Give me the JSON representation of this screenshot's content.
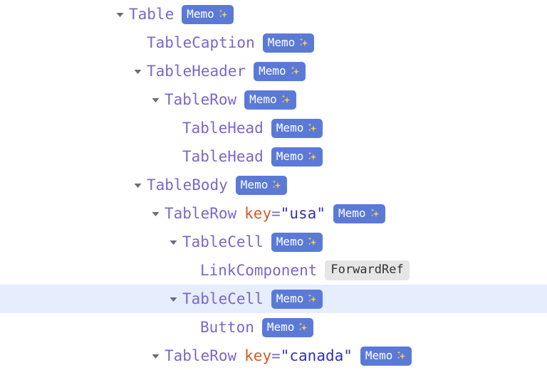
{
  "theme": {
    "background": "#ffffff",
    "selected_row_background": "#e6edfc",
    "component_name_color": "#7b68c4",
    "arrow_color": "#666e7a",
    "memo_badge_background": "#5b7ad8",
    "memo_badge_text_color": "#ffffff",
    "forwardref_badge_background": "#e6e6e6",
    "forwardref_badge_text_color": "#333333",
    "prop_key_color": "#cf5c2a",
    "prop_equals_color": "#7b68c4",
    "prop_value_color": "#3232ad"
  },
  "tree": {
    "rows": [
      {
        "name": "Table",
        "depth": 0,
        "arrow": "expanded",
        "badge": "Memo",
        "badge_icon": "sparkles-icon",
        "badge_type": "memo",
        "prop_key": "",
        "prop_value": "",
        "selected": false
      },
      {
        "name": "TableCaption",
        "depth": 1,
        "arrow": "none",
        "badge": "Memo",
        "badge_icon": "sparkles-icon",
        "badge_type": "memo",
        "prop_key": "",
        "prop_value": "",
        "selected": false
      },
      {
        "name": "TableHeader",
        "depth": 1,
        "arrow": "expanded",
        "badge": "Memo",
        "badge_icon": "sparkles-icon",
        "badge_type": "memo",
        "prop_key": "",
        "prop_value": "",
        "selected": false
      },
      {
        "name": "TableRow",
        "depth": 2,
        "arrow": "expanded",
        "badge": "Memo",
        "badge_icon": "sparkles-icon",
        "badge_type": "memo",
        "prop_key": "",
        "prop_value": "",
        "selected": false
      },
      {
        "name": "TableHead",
        "depth": 3,
        "arrow": "none",
        "badge": "Memo",
        "badge_icon": "sparkles-icon",
        "badge_type": "memo",
        "prop_key": "",
        "prop_value": "",
        "selected": false
      },
      {
        "name": "TableHead",
        "depth": 3,
        "arrow": "none",
        "badge": "Memo",
        "badge_icon": "sparkles-icon",
        "badge_type": "memo",
        "prop_key": "",
        "prop_value": "",
        "selected": false
      },
      {
        "name": "TableBody",
        "depth": 1,
        "arrow": "expanded",
        "badge": "Memo",
        "badge_icon": "sparkles-icon",
        "badge_type": "memo",
        "prop_key": "",
        "prop_value": "",
        "selected": false
      },
      {
        "name": "TableRow",
        "depth": 2,
        "arrow": "expanded",
        "badge": "Memo",
        "badge_icon": "sparkles-icon",
        "badge_type": "memo",
        "prop_key": "key",
        "prop_value": "\"usa\"",
        "selected": false
      },
      {
        "name": "TableCell",
        "depth": 3,
        "arrow": "expanded",
        "badge": "Memo",
        "badge_icon": "sparkles-icon",
        "badge_type": "memo",
        "prop_key": "",
        "prop_value": "",
        "selected": false
      },
      {
        "name": "LinkComponent",
        "depth": 4,
        "arrow": "none",
        "badge": "ForwardRef",
        "badge_icon": "",
        "badge_type": "forwardref",
        "prop_key": "",
        "prop_value": "",
        "selected": false
      },
      {
        "name": "TableCell",
        "depth": 3,
        "arrow": "expanded",
        "badge": "Memo",
        "badge_icon": "sparkles-icon",
        "badge_type": "memo",
        "prop_key": "",
        "prop_value": "",
        "selected": true
      },
      {
        "name": "Button",
        "depth": 4,
        "arrow": "none",
        "badge": "Memo",
        "badge_icon": "sparkles-icon",
        "badge_type": "memo",
        "prop_key": "",
        "prop_value": "",
        "selected": false
      },
      {
        "name": "TableRow",
        "depth": 2,
        "arrow": "expanded",
        "badge": "Memo",
        "badge_icon": "sparkles-icon",
        "badge_type": "memo",
        "prop_key": "key",
        "prop_value": "\"canada\"",
        "selected": false
      }
    ]
  }
}
